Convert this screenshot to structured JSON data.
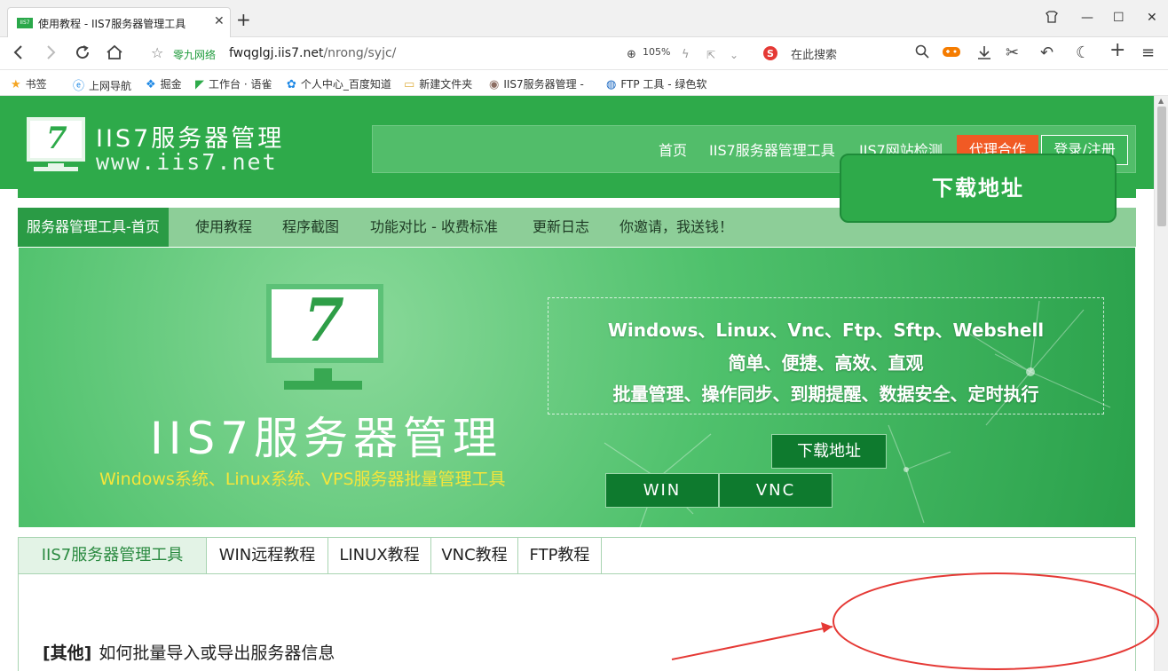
{
  "browser": {
    "tab_title": "使用教程 - IIS7服务器管理工具",
    "tab_favicon_text": "IIS7",
    "url_site_badge": "零九网络",
    "url_host": "fwqglgj.iis7.net",
    "url_path": "/nrong/syjc/",
    "zoom": "105%",
    "search_placeholder": "在此搜索",
    "bookmarks": [
      "书签",
      "上网导航",
      "掘金",
      "工作台 · 语雀",
      "个人中心_百度知道",
      "新建文件夹",
      "IIS7服务器管理 -",
      "FTP 工具 - 绿色软"
    ]
  },
  "header": {
    "logo_title": "IIS7服务器管理",
    "logo_url": "www.iis7.net",
    "logo_glyph": "7",
    "nav": [
      "首页",
      "IIS7服务器管理工具",
      "IIS7网站检测"
    ],
    "agent_button": "代理合作",
    "login_button": "登录/注册"
  },
  "subnav": {
    "items": [
      "服务器管理工具-首页",
      "使用教程",
      "程序截图",
      "功能对比 - 收费标准",
      "更新日志",
      "你邀请，我送钱！"
    ]
  },
  "banner": {
    "title": "IIS7服务器管理",
    "subtitle": "Windows系统、Linux系统、VPS服务器批量管理工具",
    "features": [
      "Windows、Linux、Vnc、Ftp、Sftp、Webshell",
      "简单、便捷、高效、直观",
      "批量管理、操作同步、到期提醒、数据安全、定时执行"
    ],
    "download_button": "下载地址",
    "win_button": "WIN",
    "vnc_button": "VNC"
  },
  "content": {
    "tabs": [
      "IIS7服务器管理工具",
      "WIN远程教程",
      "LINUX教程",
      "VNC教程",
      "FTP教程"
    ],
    "article_tag": "[其他]",
    "article_title": "如何批量导入或导出服务器信息",
    "download_button": "下载地址"
  },
  "colors": {
    "brand_green": "#2eaa4a",
    "accent_orange": "#f15a24",
    "annotation_red": "#e53935"
  }
}
